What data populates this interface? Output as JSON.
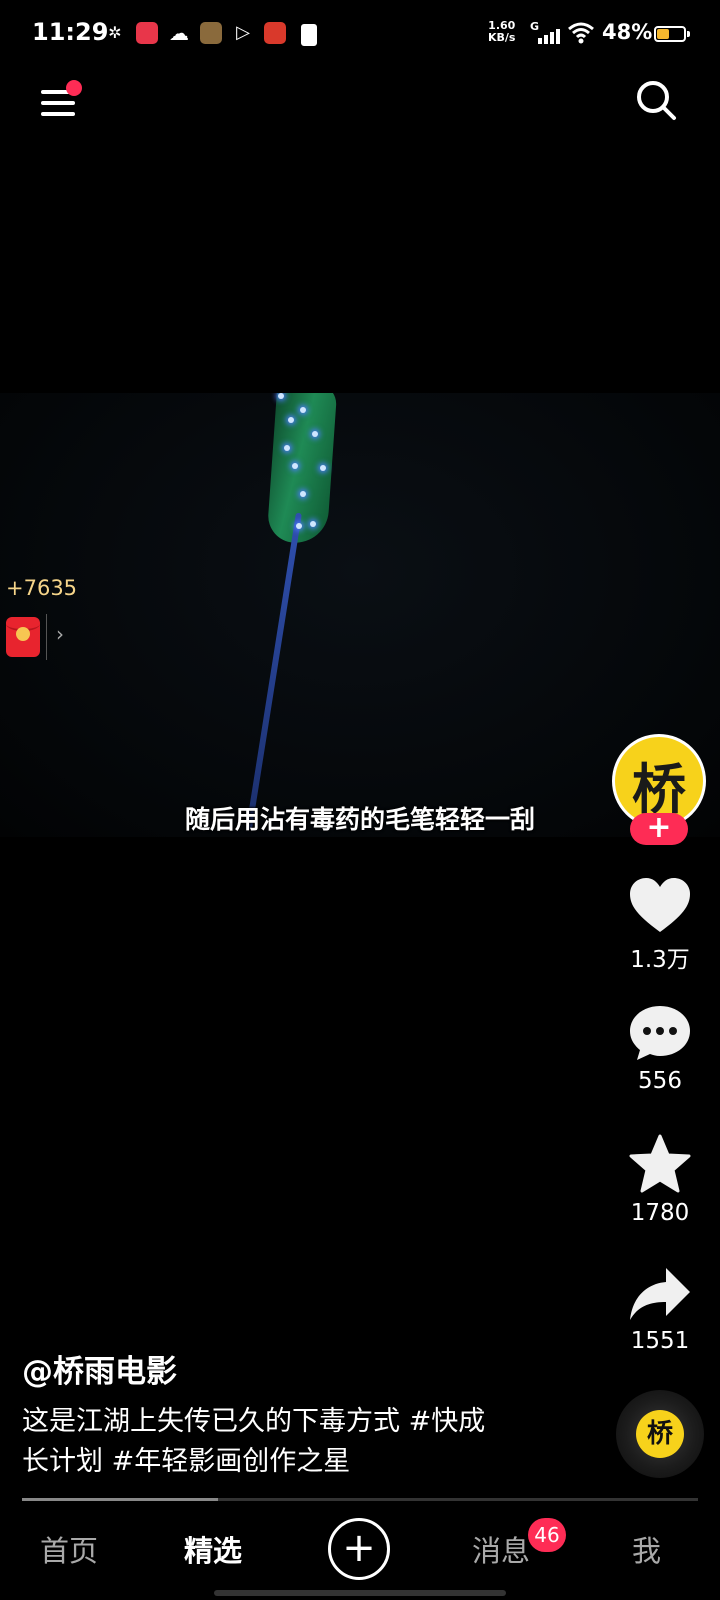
{
  "status_bar": {
    "time": "11:29",
    "network_speed": "1.60",
    "network_unit": "KB/s",
    "network_type": "G",
    "battery_percent": "48%",
    "battery_level": 0.48,
    "notification_icons": [
      "gear-icon",
      "app-icon",
      "cloud-icon",
      "game-app-icon",
      "play-icon",
      "news-app-icon",
      "sim-icon"
    ]
  },
  "top_bar": {
    "menu_icon": "menu-icon",
    "search_icon": "search-icon"
  },
  "video": {
    "subtitle": "随后用沾有毒药的毛笔轻轻一刮"
  },
  "reward": {
    "amount": "+7635",
    "icon": "red-envelope-icon",
    "chevron": "›"
  },
  "creator": {
    "avatar_char": "桥",
    "follow_label": "+"
  },
  "actions": {
    "likes": "1.3万",
    "comments": "556",
    "favorites": "1780",
    "shares": "1551"
  },
  "music": {
    "disc_char": "桥"
  },
  "caption": {
    "author": "@桥雨电影",
    "description": "这是江湖上失传已久的下毒方式 #快成长计划 #年轻影画创作之星"
  },
  "progress": {
    "fraction": 0.29
  },
  "bottom_nav": {
    "home": "首页",
    "featured": "精选",
    "create": "+",
    "messages": "消息",
    "messages_badge": "46",
    "me": "我"
  },
  "colors": {
    "accent": "#fe2c55",
    "avatar_bg": "#f7d21b",
    "battery": "#f5b82e",
    "reward_text": "#f6d58a"
  }
}
